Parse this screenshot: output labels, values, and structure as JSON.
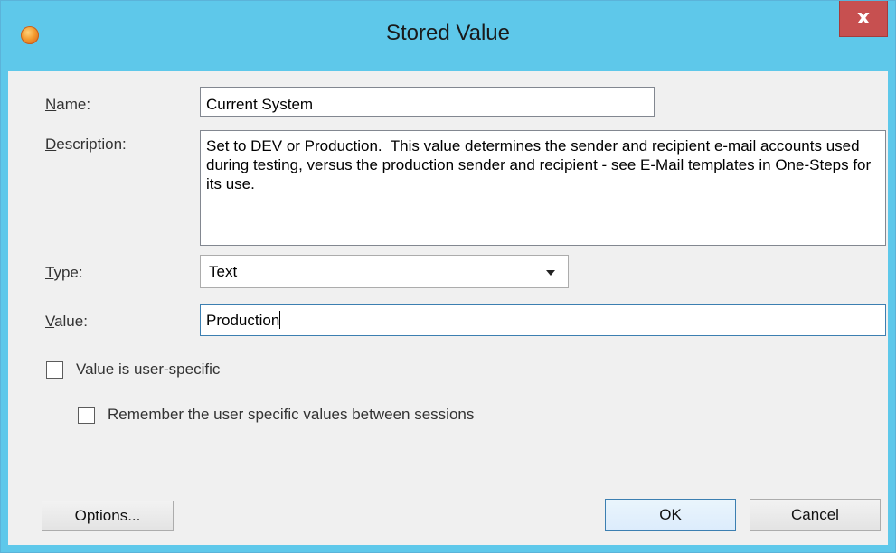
{
  "window": {
    "title": "Stored Value",
    "close_label": "x",
    "app_icon": "orange-circle-icon"
  },
  "form": {
    "name_label": "Name:",
    "name_value": "Current System",
    "description_label": "Description:",
    "description_value": "Set to DEV or Production.  This value determines the sender and recipient e-mail accounts used during testing, versus the production sender and recipient - see E-Mail templates in One-Steps for its use.",
    "type_label": "Type:",
    "type_value": "Text",
    "value_label": "Value:",
    "value_value": "Production"
  },
  "options": {
    "user_specific_label": "Value is user-specific",
    "user_specific_checked": false,
    "remember_label": "Remember the user specific values between sessions",
    "remember_checked": false
  },
  "buttons": {
    "options_label": "Options...",
    "ok_label": "OK",
    "cancel_label": "Cancel"
  },
  "colors": {
    "titlebar": "#5ec8ea",
    "close_button": "#c75050",
    "focus_border": "#3c7fb1"
  }
}
